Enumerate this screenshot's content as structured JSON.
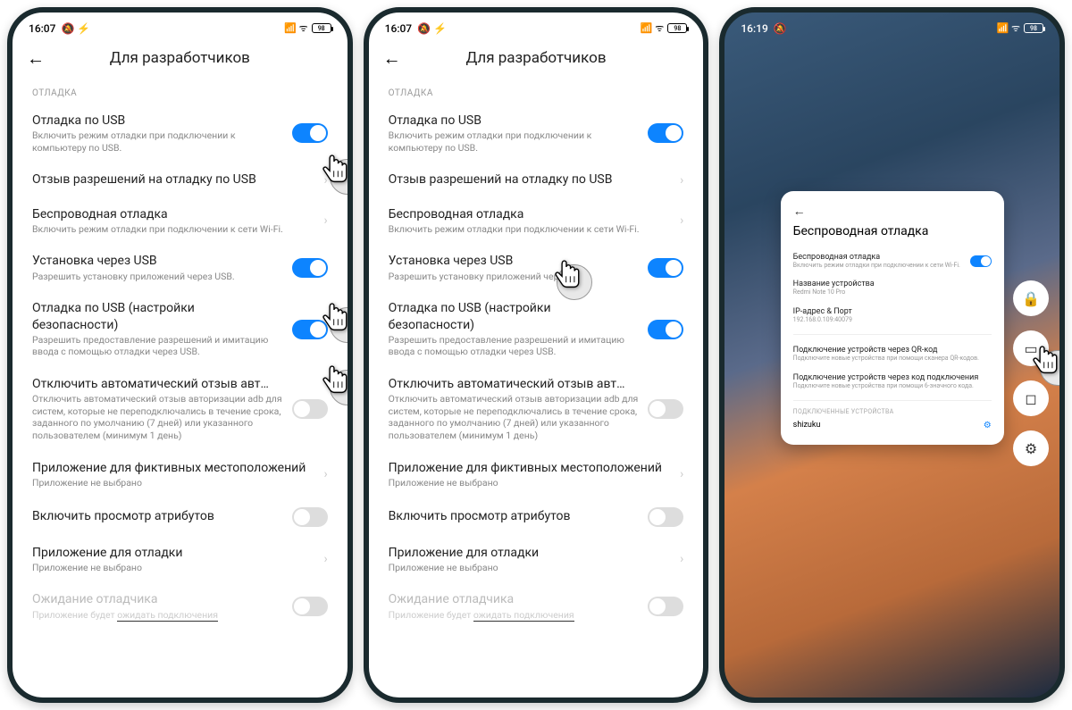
{
  "status": {
    "time1": "16:07",
    "time3": "16:19",
    "icons": "⎇ ⚡",
    "signal": "⋮⋮",
    "battery": "98"
  },
  "header": {
    "title": "Для разработчиков"
  },
  "section": "ОТЛАДКА",
  "rows": {
    "usb_debug": {
      "title": "Отладка по USB",
      "sub": "Включить режим отладки при подключении к компьютеру по USB."
    },
    "revoke": {
      "title": "Отзыв разрешений на отладку по USB"
    },
    "wireless": {
      "title": "Беспроводная отладка",
      "sub": "Включить режим отладки при подключении к сети Wi-Fi."
    },
    "install_usb": {
      "title": "Установка через USB",
      "sub": "Разрешить установку приложений через USB."
    },
    "usb_sec": {
      "title": "Отладка по USB (настройки безопасности)",
      "sub": "Разрешить предоставление разрешений и имитацию ввода с помощью отладки через USB."
    },
    "auto_revoke": {
      "title": "Отключить автоматический отзыв авт…",
      "sub": "Отключить автоматический отзыв авторизации adb для систем, которые не переподключались в течение срока, заданного по умолчанию (7 дней) или указанного пользователем (минимум 1 день)"
    },
    "mock_loc": {
      "title": "Приложение для фиктивных местоположений",
      "sub": "Приложение не выбрано"
    },
    "attr_view": {
      "title": "Включить просмотр атрибутов"
    },
    "debug_app": {
      "title": "Приложение для отладки",
      "sub": "Приложение не выбрано"
    },
    "wait_debug": {
      "title": "Ожидание отладчика",
      "sub_a": "Приложение будет ",
      "sub_b": "ожидать подключения"
    }
  },
  "card": {
    "title": "Беспроводная отладка",
    "r1": {
      "t": "Беспроводная отладка",
      "s": "Включить режим отладки при подключении к сети Wi-Fi."
    },
    "r2": {
      "t": "Название устройства",
      "s": "Redmi Note 10 Pro"
    },
    "r3": {
      "t": "IP-адрес & Порт",
      "s": "192.168.0.109:40079"
    },
    "r4": {
      "t": "Подключение устройств через QR-код",
      "s": "Подключите новые устройства при помощи сканера QR-кодов."
    },
    "r5": {
      "t": "Подключение устройств через код подключения",
      "s": "Подключите новые устройства при помощи 6-значного кода."
    },
    "sec": "ПОДКЛЮЧЕННЫЕ УСТРОЙСТВА",
    "dev": "shizuku"
  }
}
